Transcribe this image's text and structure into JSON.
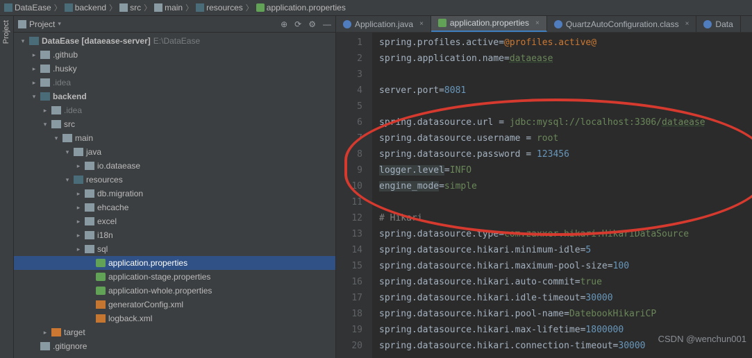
{
  "breadcrumb": [
    {
      "icon": "modfolder",
      "label": "DataEase"
    },
    {
      "icon": "modfolder",
      "label": "backend"
    },
    {
      "icon": "folder",
      "label": "src"
    },
    {
      "icon": "folder",
      "label": "main"
    },
    {
      "icon": "modfolder",
      "label": "resources"
    },
    {
      "icon": "props",
      "label": "application.properties"
    }
  ],
  "project_tab": "Project",
  "sidebar": {
    "title": "Project",
    "tools": [
      "target",
      "reload",
      "gear",
      "collapse"
    ]
  },
  "tree": [
    {
      "d": 0,
      "arrow": "v",
      "icon": "modfolder",
      "name": "DataEase [dataease-server]",
      "suffix": " E:\\DataEase",
      "bold": true
    },
    {
      "d": 1,
      "arrow": ">",
      "icon": "folder",
      "name": ".github"
    },
    {
      "d": 1,
      "arrow": ">",
      "icon": "folder",
      "name": ".husky"
    },
    {
      "d": 1,
      "arrow": ">",
      "icon": "folder",
      "name": ".idea",
      "muted": true
    },
    {
      "d": 1,
      "arrow": "v",
      "icon": "modfolder",
      "name": "backend",
      "bold": true
    },
    {
      "d": 2,
      "arrow": ">",
      "icon": "folder",
      "name": ".idea",
      "muted": true
    },
    {
      "d": 2,
      "arrow": "v",
      "icon": "folder",
      "name": "src"
    },
    {
      "d": 3,
      "arrow": "v",
      "icon": "folder",
      "name": "main"
    },
    {
      "d": 4,
      "arrow": "v",
      "icon": "folder",
      "name": "java",
      "blue": true
    },
    {
      "d": 5,
      "arrow": ">",
      "icon": "folder",
      "name": "io.dataease"
    },
    {
      "d": 4,
      "arrow": "v",
      "icon": "modfolder",
      "name": "resources"
    },
    {
      "d": 5,
      "arrow": ">",
      "icon": "folder",
      "name": "db.migration"
    },
    {
      "d": 5,
      "arrow": ">",
      "icon": "folder",
      "name": "ehcache"
    },
    {
      "d": 5,
      "arrow": ">",
      "icon": "folder",
      "name": "excel"
    },
    {
      "d": 5,
      "arrow": ">",
      "icon": "folder",
      "name": "i18n"
    },
    {
      "d": 5,
      "arrow": ">",
      "icon": "folder",
      "name": "sql"
    },
    {
      "d": 6,
      "arrow": "",
      "icon": "props",
      "name": "application.properties",
      "sel": true
    },
    {
      "d": 6,
      "arrow": "",
      "icon": "props",
      "name": "application-stage.properties"
    },
    {
      "d": 6,
      "arrow": "",
      "icon": "props",
      "name": "application-whole.properties"
    },
    {
      "d": 6,
      "arrow": "",
      "icon": "xml",
      "name": "generatorConfig.xml"
    },
    {
      "d": 6,
      "arrow": "",
      "icon": "xml",
      "name": "logback.xml"
    },
    {
      "d": 2,
      "arrow": ">",
      "icon": "orange",
      "name": "target",
      "orangeText": true
    },
    {
      "d": 1,
      "arrow": "",
      "icon": "folder",
      "name": ".gitignore",
      "cut": true
    }
  ],
  "tabs": [
    {
      "icon": "java",
      "label": "Application.java",
      "active": false
    },
    {
      "icon": "props",
      "label": "application.properties",
      "active": true
    },
    {
      "icon": "classfile",
      "label": "QuartzAutoConfiguration.class",
      "active": false
    },
    {
      "icon": "java",
      "label": "Data",
      "active": false,
      "clip": true
    }
  ],
  "code": {
    "lines": [
      {
        "n": 1,
        "seg": [
          {
            "t": "spring.profiles.active",
            "c": "k"
          },
          {
            "t": "=",
            "c": "eq"
          },
          {
            "t": "@profiles.active@",
            "c": "vlit"
          }
        ]
      },
      {
        "n": 2,
        "seg": [
          {
            "t": "spring.application.name",
            "c": "k"
          },
          {
            "t": "=",
            "c": "eq"
          },
          {
            "t": "dataease",
            "c": "v",
            "u": true
          }
        ]
      },
      {
        "n": 3,
        "seg": []
      },
      {
        "n": 4,
        "seg": [
          {
            "t": "server.port",
            "c": "k"
          },
          {
            "t": "=",
            "c": "eq"
          },
          {
            "t": "8081",
            "c": "vnum"
          }
        ]
      },
      {
        "n": 5,
        "seg": []
      },
      {
        "n": 6,
        "seg": [
          {
            "t": "spring.datasource.url",
            "c": "k"
          },
          {
            "t": " = ",
            "c": "eq"
          },
          {
            "t": "jdbc:mysql://localhost:3306/",
            "c": "v"
          },
          {
            "t": "dataease",
            "c": "v",
            "u": true
          }
        ]
      },
      {
        "n": 7,
        "seg": [
          {
            "t": "spring.datasource.username",
            "c": "k"
          },
          {
            "t": " = ",
            "c": "eq"
          },
          {
            "t": "root",
            "c": "v"
          }
        ]
      },
      {
        "n": 8,
        "seg": [
          {
            "t": "spring.datasource.password",
            "c": "k"
          },
          {
            "t": " = ",
            "c": "eq"
          },
          {
            "t": "123456",
            "c": "vnum"
          }
        ]
      },
      {
        "n": 9,
        "seg": [
          {
            "t": "logger.level",
            "c": "k",
            "hl": true
          },
          {
            "t": "=",
            "c": "eq"
          },
          {
            "t": "INFO",
            "c": "v"
          }
        ]
      },
      {
        "n": 10,
        "seg": [
          {
            "t": "engine_mode",
            "c": "k",
            "hl": true
          },
          {
            "t": "=",
            "c": "eq"
          },
          {
            "t": "simple",
            "c": "v"
          }
        ]
      },
      {
        "n": 11,
        "seg": []
      },
      {
        "n": 12,
        "seg": [
          {
            "t": "# Hikari",
            "c": "cm"
          }
        ]
      },
      {
        "n": 13,
        "seg": [
          {
            "t": "spring.datasource.type",
            "c": "k"
          },
          {
            "t": "=",
            "c": "eq"
          },
          {
            "t": "com.zaxxer.hikari.HikariDataSource",
            "c": "v"
          }
        ]
      },
      {
        "n": 14,
        "seg": [
          {
            "t": "spring.datasource.hikari.minimum-idle",
            "c": "k"
          },
          {
            "t": "=",
            "c": "eq"
          },
          {
            "t": "5",
            "c": "vnum"
          }
        ]
      },
      {
        "n": 15,
        "seg": [
          {
            "t": "spring.datasource.hikari.maximum-pool-size",
            "c": "k"
          },
          {
            "t": "=",
            "c": "eq"
          },
          {
            "t": "100",
            "c": "vnum"
          }
        ]
      },
      {
        "n": 16,
        "seg": [
          {
            "t": "spring.datasource.hikari.auto-commit",
            "c": "k"
          },
          {
            "t": "=",
            "c": "eq"
          },
          {
            "t": "true",
            "c": "v"
          }
        ]
      },
      {
        "n": 17,
        "seg": [
          {
            "t": "spring.datasource.hikari.idle-timeout",
            "c": "k"
          },
          {
            "t": "=",
            "c": "eq"
          },
          {
            "t": "30000",
            "c": "vnum"
          }
        ]
      },
      {
        "n": 18,
        "seg": [
          {
            "t": "spring.datasource.hikari.pool-name",
            "c": "k"
          },
          {
            "t": "=",
            "c": "eq"
          },
          {
            "t": "DatebookHikariCP",
            "c": "v"
          }
        ]
      },
      {
        "n": 19,
        "seg": [
          {
            "t": "spring.datasource.hikari.max-lifetime",
            "c": "k"
          },
          {
            "t": "=",
            "c": "eq"
          },
          {
            "t": "1800000",
            "c": "vnum"
          }
        ]
      },
      {
        "n": 20,
        "seg": [
          {
            "t": "spring.datasource.hikari.connection-timeout",
            "c": "k"
          },
          {
            "t": "=",
            "c": "eq"
          },
          {
            "t": "30000",
            "c": "vnum"
          }
        ]
      }
    ]
  },
  "watermark": "CSDN @wenchun001"
}
